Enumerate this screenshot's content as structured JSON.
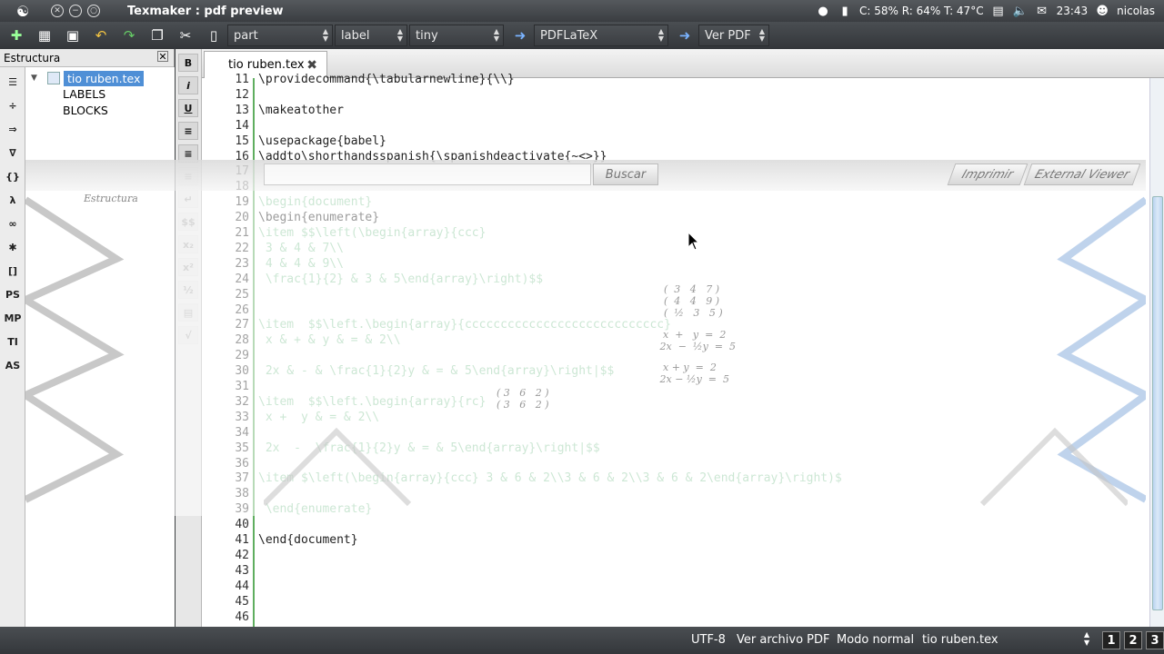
{
  "titlebar": {
    "title": "Texmaker : pdf preview",
    "tray": {
      "stats": "C: 58% R: 64% T:  47°C",
      "time": "23:43",
      "user": "nicolas"
    }
  },
  "toolbar": {
    "combos": [
      {
        "value": "part"
      },
      {
        "value": "label"
      },
      {
        "value": "tiny"
      },
      {
        "value": "PDFLaTeX"
      },
      {
        "value": "Ver PDF"
      }
    ]
  },
  "structure": {
    "title": "Estructura",
    "root": "tio ruben.tex",
    "children": [
      "LABELS",
      "BLOCKS"
    ]
  },
  "editor": {
    "tab": "tio ruben.tex",
    "lines": [
      {
        "n": "11",
        "text": "\\providecommand{\\tabularnewline}{\\\\}",
        "ghost": false
      },
      {
        "n": "12",
        "text": "",
        "ghost": false
      },
      {
        "n": "13",
        "text": "\\makeatother",
        "ghost": false
      },
      {
        "n": "14",
        "text": "",
        "ghost": false
      },
      {
        "n": "15",
        "text": "\\usepackage{babel}",
        "ghost": false
      },
      {
        "n": "16",
        "text": "\\addto\\shorthandsspanish{\\spanishdeactivate{~<>}}",
        "ghost": false
      },
      {
        "n": "17",
        "text": "",
        "ghost": false
      },
      {
        "n": "18",
        "text": "",
        "ghost": false
      },
      {
        "n": "19",
        "text": "\\begin{document}",
        "ghost": true
      },
      {
        "n": "20",
        "text": "\\begin{enumerate}",
        "ghost": false
      },
      {
        "n": "21",
        "text": "\\item $$\\left(\\begin{array}{ccc}",
        "ghost": true
      },
      {
        "n": "22",
        "text": " 3 & 4 & 7\\\\",
        "ghost": true
      },
      {
        "n": "23",
        "text": " 4 & 4 & 9\\\\",
        "ghost": true
      },
      {
        "n": "24",
        "text": " \\frac{1}{2} & 3 & 5\\end{array}\\right)$$",
        "ghost": true
      },
      {
        "n": "25",
        "text": "",
        "ghost": false
      },
      {
        "n": "26",
        "text": "",
        "ghost": false
      },
      {
        "n": "27",
        "text": "\\item  $$\\left.\\begin{array}{cccccccccccccccccccccccccccc}",
        "ghost": true
      },
      {
        "n": "28",
        "text": " x & + & y & = & 2\\\\",
        "ghost": true
      },
      {
        "n": "29",
        "text": "",
        "ghost": false
      },
      {
        "n": "30",
        "text": " 2x & - & \\frac{1}{2}y & = & 5\\end{array}\\right|$$",
        "ghost": true
      },
      {
        "n": "31",
        "text": "",
        "ghost": false
      },
      {
        "n": "32",
        "text": "\\item  $$\\left.\\begin{array}{rc}",
        "ghost": true
      },
      {
        "n": "33",
        "text": " x +  y & = & 2\\\\",
        "ghost": true
      },
      {
        "n": "34",
        "text": "",
        "ghost": false
      },
      {
        "n": "35",
        "text": " 2x  -  \\frac{1}{2}y & = & 5\\end{array}\\right|$$",
        "ghost": true
      },
      {
        "n": "36",
        "text": "",
        "ghost": false
      },
      {
        "n": "37",
        "text": "\\item $\\left(\\begin{array}{ccc} 3 & 6 & 2\\\\3 & 6 & 2\\\\3 & 6 & 2\\end{array}\\right)$",
        "ghost": true
      },
      {
        "n": "38",
        "text": "",
        "ghost": false
      },
      {
        "n": "39",
        "text": " \\end{enumerate}",
        "ghost": true
      },
      {
        "n": "40",
        "text": "",
        "ghost": false
      },
      {
        "n": "41",
        "text": "\\end{document}",
        "ghost": false
      },
      {
        "n": "42",
        "text": "",
        "ghost": false
      },
      {
        "n": "43",
        "text": "",
        "ghost": false
      },
      {
        "n": "44",
        "text": "",
        "ghost": false
      },
      {
        "n": "45",
        "text": "",
        "ghost": false
      },
      {
        "n": "46",
        "text": "",
        "ghost": false
      }
    ]
  },
  "overlay": {
    "search_button": "Buscar",
    "print_button": "Imprimir",
    "viewer_button": "External Viewer",
    "structure_ghost": "Estructura"
  },
  "statusbar": {
    "encoding": "UTF-8",
    "view_pdf": "Ver archivo PDF",
    "mode": "Modo normal",
    "file": "tio ruben.tex",
    "views": [
      "1",
      "2",
      "3"
    ]
  }
}
